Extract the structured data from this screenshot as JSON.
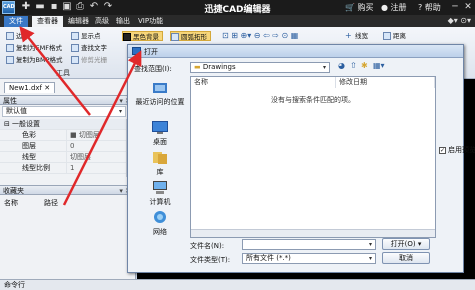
{
  "titlebar": {
    "app_icon_text": "CAD",
    "title": "迅捷CAD编辑器",
    "buy": "购买",
    "register": "注册",
    "help": "帮助",
    "minimize": "─",
    "close": "✕"
  },
  "menubar": {
    "items": [
      "文件",
      "查看器",
      "编辑器",
      "高级",
      "输出",
      "VIP功能"
    ]
  },
  "ribbon": {
    "btn_frame": "边框",
    "btn_copy_emf": "复制为EMF格式",
    "btn_copy_bmp": "复制为BMP格式",
    "btn_show_points": "显示点",
    "btn_find_text": "查找文字",
    "btn_edit_text": "修剪光栅",
    "btn_black_bg": "黑色背景",
    "btn_round_fill": "圆弧拓形",
    "group_tools": "工具",
    "btn_line_width": "线宽",
    "btn_distance": "距离"
  },
  "leftpanel": {
    "doc_tab": "New1.dxf",
    "properties_header": "属性",
    "default_select": "默认值",
    "general_section": "一般设置",
    "props": [
      {
        "key": "色彩",
        "value": "■ 切图层"
      },
      {
        "key": "图层",
        "value": "0"
      },
      {
        "key": "线型",
        "value": "切图层"
      },
      {
        "key": "线型比例",
        "value": "1"
      }
    ],
    "favorites_header": "收藏夹",
    "col_name": "名称",
    "col_path": "路径"
  },
  "statusbar": {
    "text": "命令行"
  },
  "dialog": {
    "title": "打开",
    "lookin_label": "查找范围(I):",
    "lookin_value": "Drawings",
    "places": [
      "最近访问的位置",
      "桌面",
      "库",
      "计算机",
      "网络"
    ],
    "col_name": "名称",
    "col_modified": "修改日期",
    "empty_message": "没有与搜索条件匹配的项。",
    "filename_label": "文件名(N):",
    "filename_value": "",
    "filetype_label": "文件类型(T):",
    "filetype_value": "所有文件 (*.*)",
    "open_button": "打开(O)",
    "cancel_button": "取消",
    "checkbox_label": "启用预览"
  }
}
